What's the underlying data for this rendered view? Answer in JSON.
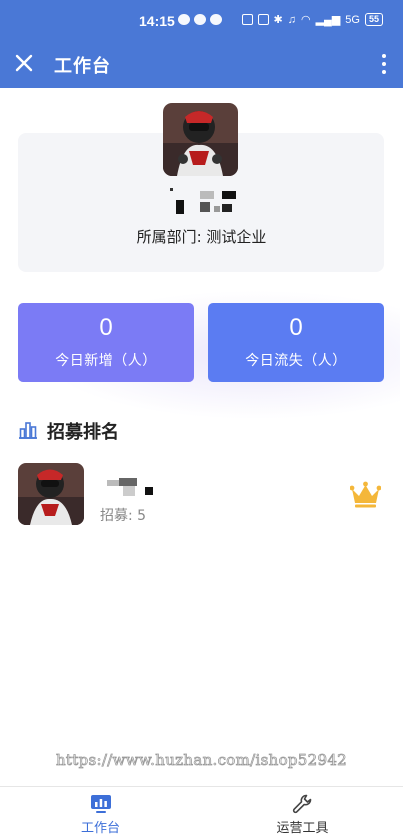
{
  "status_bar": {
    "time": "14:15",
    "battery": "55",
    "signal_label": "5G"
  },
  "app_bar": {
    "title": "工作台",
    "close_icon": "close-icon",
    "more_icon": "more-vertical-icon"
  },
  "profile": {
    "department_label": "所属部门:",
    "department_value": "测试企业",
    "department_text": "所属部门: 测试企业"
  },
  "stats": [
    {
      "value": "0",
      "label": "今日新增（人）",
      "color": "#7b7bf5"
    },
    {
      "value": "0",
      "label": "今日流失（人）",
      "color": "#5b7cf2"
    }
  ],
  "ranking": {
    "title": "招募排名",
    "icon": "bar-chart-icon",
    "items": [
      {
        "count_text": "招募: 5",
        "badge_icon": "crown-icon",
        "badge_color": "#f4b73a"
      }
    ]
  },
  "watermark": "https://www.huzhan.com/ishop52942",
  "bottom_nav": [
    {
      "label": "工作台",
      "icon": "dashboard-icon",
      "active": true,
      "color": "#3d6fd8"
    },
    {
      "label": "运营工具",
      "icon": "wrench-icon",
      "active": false,
      "color": "#333333"
    }
  ],
  "colors": {
    "header": "#4a78d6",
    "card_bg": "#f4f5f8",
    "accent": "#3d6fd8"
  }
}
